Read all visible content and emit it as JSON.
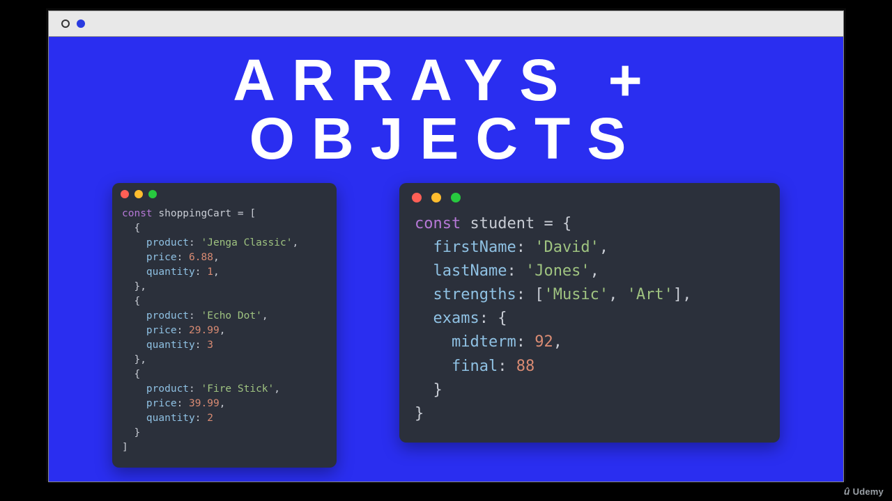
{
  "title": "ARRAYS + OBJECTS",
  "watermark": "Udemy",
  "left_code": {
    "keyword": "const",
    "varname": "shoppingCart",
    "items": [
      {
        "product": "'Jenga Classic'",
        "price": "6.88",
        "quantity": "1"
      },
      {
        "product": "'Echo Dot'",
        "price": "29.99",
        "quantity": "3"
      },
      {
        "product": "'Fire Stick'",
        "price": "39.99",
        "quantity": "2"
      }
    ]
  },
  "right_code": {
    "keyword": "const",
    "varname": "student",
    "firstName": "'David'",
    "lastName": "'Jones'",
    "strengths": [
      "'Music'",
      "'Art'"
    ],
    "exams": {
      "midterm": "92",
      "final": "88"
    }
  }
}
